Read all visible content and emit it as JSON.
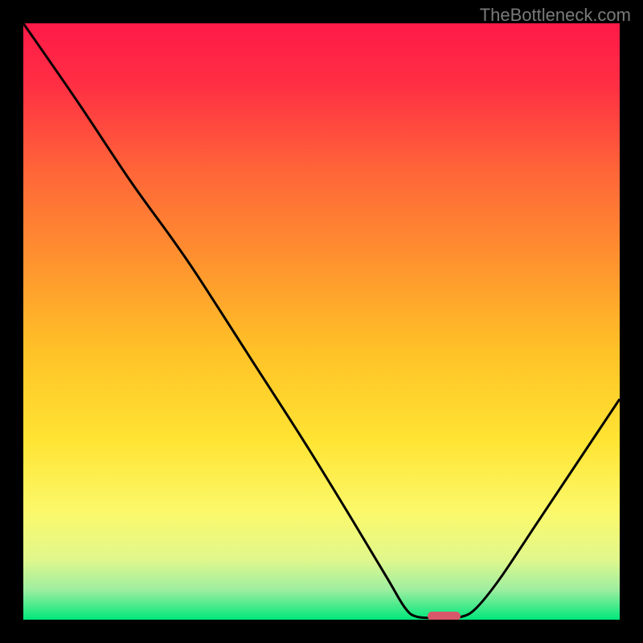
{
  "watermark": "TheBottleneck.com",
  "chart_data": {
    "type": "line",
    "title": "",
    "xlabel": "",
    "ylabel": "",
    "xlim": [
      0,
      100
    ],
    "ylim": [
      0,
      100
    ],
    "gradient_stops": [
      {
        "offset": 0,
        "color": "#ff1a48"
      },
      {
        "offset": 10,
        "color": "#ff2e44"
      },
      {
        "offset": 25,
        "color": "#ff6638"
      },
      {
        "offset": 40,
        "color": "#ff932f"
      },
      {
        "offset": 55,
        "color": "#ffc227"
      },
      {
        "offset": 70,
        "color": "#ffe433"
      },
      {
        "offset": 82,
        "color": "#fbf96b"
      },
      {
        "offset": 90,
        "color": "#e0f78c"
      },
      {
        "offset": 95,
        "color": "#9deea0"
      },
      {
        "offset": 100,
        "color": "#00e77a"
      }
    ],
    "series": [
      {
        "name": "bottleneck-curve",
        "points": [
          {
            "x": 0.0,
            "y": 100.0
          },
          {
            "x": 9.0,
            "y": 87.0
          },
          {
            "x": 18.0,
            "y": 73.5
          },
          {
            "x": 24.5,
            "y": 64.5
          },
          {
            "x": 29.0,
            "y": 58.0
          },
          {
            "x": 38.0,
            "y": 44.0
          },
          {
            "x": 47.0,
            "y": 30.0
          },
          {
            "x": 55.0,
            "y": 17.0
          },
          {
            "x": 61.0,
            "y": 7.0
          },
          {
            "x": 64.0,
            "y": 2.0
          },
          {
            "x": 66.0,
            "y": 0.5
          },
          {
            "x": 70.0,
            "y": 0.3
          },
          {
            "x": 73.5,
            "y": 0.5
          },
          {
            "x": 76.0,
            "y": 2.0
          },
          {
            "x": 80.0,
            "y": 7.0
          },
          {
            "x": 86.0,
            "y": 16.0
          },
          {
            "x": 93.0,
            "y": 26.5
          },
          {
            "x": 100.0,
            "y": 37.0
          }
        ]
      }
    ],
    "marker": {
      "x": 70.5,
      "y": 0.6,
      "w": 5.5,
      "h": 1.6,
      "color": "#d9576b"
    }
  }
}
